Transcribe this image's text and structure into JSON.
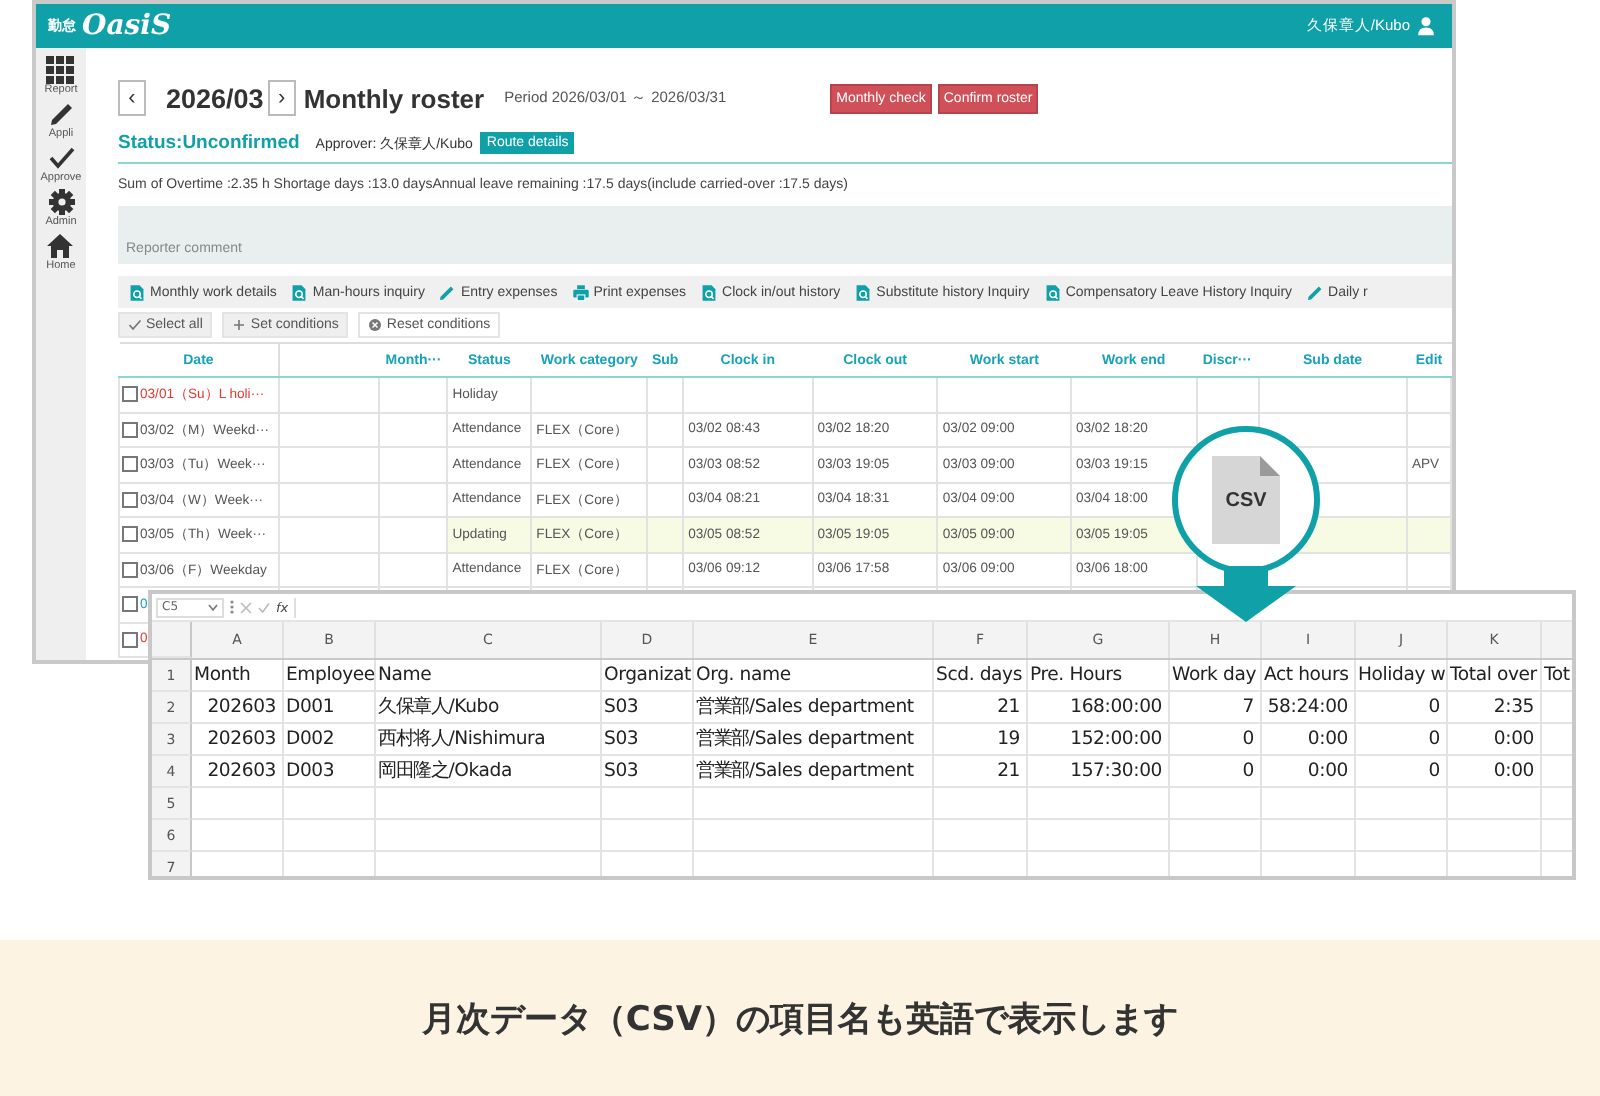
{
  "app": {
    "logo_small": "勤怠",
    "logo": "OasiS",
    "user": "久保章人/Kubo",
    "sidebar": [
      {
        "label": "Report"
      },
      {
        "label": "Appli"
      },
      {
        "label": "Approve"
      },
      {
        "label": "Admin"
      },
      {
        "label": "Home"
      }
    ],
    "prev": "‹",
    "month": "2026/03",
    "next": "›",
    "title": "Monthly roster",
    "period": "Period 2026/03/01 ～ 2026/03/31",
    "actions": [
      "Monthly check",
      "Confirm roster"
    ],
    "status": "Status:Unconfirmed",
    "approver": "Approver: 久保章人/Kubo",
    "route_button": "Route details",
    "summary": "Sum of Overtime :2.35 h  Shortage days :13.0 daysAnnual leave remaining :17.5 days(include carried-over :17.5 days)",
    "comment_placeholder": "Reporter comment",
    "toolbar": [
      {
        "label": "Monthly work details"
      },
      {
        "label": "Man-hours inquiry"
      },
      {
        "label": "Entry expenses"
      },
      {
        "label": "Print expenses"
      },
      {
        "label": "Clock in/out history"
      },
      {
        "label": "Substitute history Inquiry"
      },
      {
        "label": "Compensatory Leave History Inquiry"
      },
      {
        "label": "Daily r"
      }
    ],
    "filters": [
      {
        "label": "Select all"
      },
      {
        "label": "Set conditions"
      },
      {
        "label": "Reset conditions"
      }
    ],
    "table": {
      "columns": [
        "Date",
        "Month···",
        "Status",
        "Work category",
        "Sub",
        "Clock in",
        "Clock out",
        "Work start",
        "Work end",
        "Discr···",
        "Sub date",
        "Edit"
      ],
      "rows": [
        {
          "date": "03/01（Su）L holi···",
          "color": "#e53935",
          "checked": false,
          "highlighted": false,
          "status": "Holiday"
        },
        {
          "date": "03/02（M）Weekd···",
          "color": "#555555",
          "checked": false,
          "highlighted": false,
          "status": "Attendance",
          "category": "FLEX（Core）",
          "clock_in": "03/02 08:43",
          "clock_out": "03/02 18:20",
          "work_start": "03/02 09:00",
          "work_end": "03/02 18:20"
        },
        {
          "date": "03/03（Tu）Week···",
          "color": "#555555",
          "checked": false,
          "highlighted": false,
          "status": "Attendance",
          "category": "FLEX（Core）",
          "clock_in": "03/03 08:52",
          "clock_out": "03/03 19:05",
          "work_start": "03/03 09:00",
          "work_end": "03/03 19:15",
          "edit": "APV"
        },
        {
          "date": "03/04（W）Week···",
          "color": "#555555",
          "checked": false,
          "highlighted": false,
          "status": "Attendance",
          "category": "FLEX（Core）",
          "clock_in": "03/04 08:21",
          "clock_out": "03/04 18:31",
          "work_start": "03/04 09:00",
          "work_end": "03/04 18:00"
        },
        {
          "date": "03/05（Th）Week···",
          "color": "#555555",
          "checked": false,
          "highlighted": true,
          "status": "Updating",
          "category": "FLEX（Core）",
          "clock_in": "03/05 08:52",
          "clock_out": "03/05 19:05",
          "work_start": "03/05 09:00",
          "work_end": "03/05 19:05"
        },
        {
          "date": "03/06（F）Weekday",
          "color": "#555555",
          "checked": false,
          "highlighted": false,
          "status": "Attendance",
          "category": "FLEX（Core）",
          "clock_in": "03/06 09:12",
          "clock_out": "03/06 17:58",
          "work_start": "03/06 09:00",
          "work_end": "03/06 18:00"
        },
        {
          "date": "0",
          "color": "#17a2b8",
          "checked": false
        },
        {
          "date": "0",
          "color": "#e53935",
          "checked": false
        }
      ]
    }
  },
  "csv_badge": "CSV",
  "sheet": {
    "name_box": "C5",
    "formula_label": "fx",
    "columns": [
      "A",
      "B",
      "C",
      "D",
      "E",
      "F",
      "G",
      "H",
      "I",
      "J",
      "K"
    ],
    "rows": [
      {
        "number": "1",
        "kind": "header",
        "cells": {
          "A": "Month",
          "B": "Employee",
          "C": "Name",
          "D": "Organizat",
          "E": "Org. name",
          "F": "Scd. days",
          "G": "Pre. Hours",
          "H": "Work day",
          "I": "Act hours",
          "J": "Holiday w",
          "K": "Total over",
          "L": "Tot"
        }
      },
      {
        "number": "2",
        "kind": "data",
        "cells": {
          "A": "202603",
          "B": "D001",
          "C": "久保章人/Kubo",
          "D": "S03",
          "E": "営業部/Sales department",
          "F": "21",
          "G": "168:00:00",
          "H": "7",
          "I": "58:24:00",
          "J": "0",
          "K": "2:35"
        }
      },
      {
        "number": "3",
        "kind": "data",
        "cells": {
          "A": "202603",
          "B": "D002",
          "C": "西村将人/Nishimura",
          "D": "S03",
          "E": "営業部/Sales department",
          "F": "19",
          "G": "152:00:00",
          "H": "0",
          "I": "0:00",
          "J": "0",
          "K": "0:00"
        }
      },
      {
        "number": "4",
        "kind": "data",
        "cells": {
          "A": "202603",
          "B": "D003",
          "C": "岡田隆之/Okada",
          "D": "S03",
          "E": "営業部/Sales department",
          "F": "21",
          "G": "157:30:00",
          "H": "0",
          "I": "0:00",
          "J": "0",
          "K": "0:00"
        }
      },
      {
        "number": "5",
        "kind": "data",
        "cells": {}
      },
      {
        "number": "6",
        "kind": "data",
        "cells": {}
      },
      {
        "number": "7",
        "kind": "data",
        "cells": {}
      }
    ]
  },
  "caption": "月次データ（CSV）の項目名も英語で表示します"
}
